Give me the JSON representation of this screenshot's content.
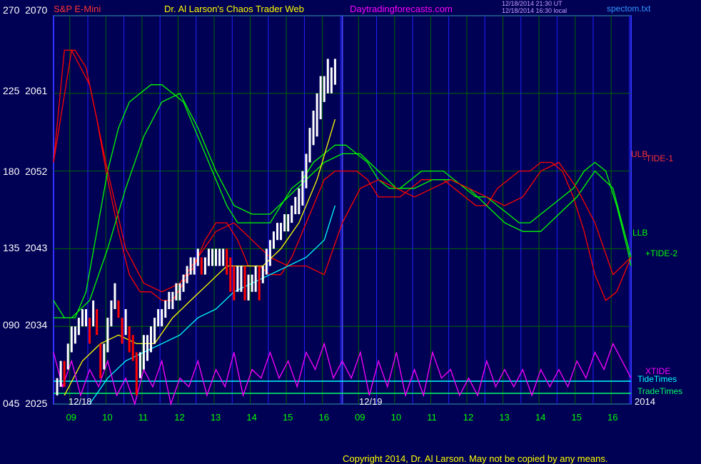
{
  "header": {
    "instrument": "S&P E-Mini",
    "site": "Dr. Al Larson's Chaos Trader Web",
    "url": "Daytradingforecasts.com",
    "timestamp_ut": "12/18/2014 21:30 UT",
    "timestamp_local": "12/18/2014 16:30 local",
    "file": "spectom.txt"
  },
  "footer": {
    "copyright": "Copyright 2014, Dr. Al Larson. May not be copied by any means."
  },
  "colors": {
    "background": "#000055",
    "plot_frame": "#3333ff",
    "grid": "#006600",
    "red": "#ff0000",
    "green": "#00ff00",
    "cyan": "#00ffff",
    "magenta": "#ff00ff",
    "yellow": "#ffff00",
    "white": "#ffffff"
  },
  "chart_data": {
    "type": "line",
    "left_axis_ticks": [
      {
        "tide": "270",
        "price": "2070",
        "value": 2070
      },
      {
        "tide": "225",
        "price": "2061",
        "value": 2061
      },
      {
        "tide": "180",
        "price": "2052",
        "value": 2052
      },
      {
        "tide": "135",
        "price": "2043",
        "value": 2043
      },
      {
        "tide": "090",
        "price": "2034",
        "value": 2034
      },
      {
        "tide": "045",
        "price": "2025",
        "value": 2025
      }
    ],
    "ylim": [
      2025,
      2070
    ],
    "x_range_hours": [
      0,
      16
    ],
    "x_hour_labels": [
      "09",
      "10",
      "11",
      "12",
      "13",
      "14",
      "15",
      "16",
      "09",
      "10",
      "11",
      "12",
      "13",
      "14",
      "15",
      "16"
    ],
    "date_labels": [
      {
        "label": "12/18",
        "x": 0.4
      },
      {
        "label": "12/19",
        "x": 8.5
      },
      {
        "label": "2014",
        "x": 16.1
      }
    ],
    "day_divider_x": 8,
    "now_x": 7.9,
    "right_labels": {
      "ulb": "ULB",
      "tide1": "-TIDE-1",
      "llb": "LLB",
      "tide2": "+TIDE-2",
      "xtide": "XTIDE",
      "tide_times": "TideTimes",
      "trade_times": "TradeTimes"
    },
    "price_series": {
      "name": "S&P E-Mini",
      "x": [
        0.1,
        0.2,
        0.3,
        0.4,
        0.5,
        0.6,
        0.7,
        0.8,
        0.9,
        1.0,
        1.1,
        1.2,
        1.3,
        1.4,
        1.5,
        1.6,
        1.7,
        1.8,
        1.9,
        2.0,
        2.1,
        2.2,
        2.3,
        2.4,
        2.5,
        2.6,
        2.7,
        2.8,
        2.9,
        3.0,
        3.1,
        3.2,
        3.3,
        3.4,
        3.5,
        3.6,
        3.7,
        3.8,
        3.9,
        4.0,
        4.1,
        4.2,
        4.3,
        4.4,
        4.5,
        4.6,
        4.7,
        4.8,
        4.9,
        5.0,
        5.1,
        5.2,
        5.3,
        5.4,
        5.5,
        5.6,
        5.7,
        5.8,
        5.9,
        6.0,
        6.1,
        6.2,
        6.3,
        6.4,
        6.5,
        6.6,
        6.7,
        6.8,
        6.9,
        7.0,
        7.1,
        7.2,
        7.3,
        7.4,
        7.5,
        7.6,
        7.7,
        7.8
      ],
      "close": [
        2027,
        2029,
        2028,
        2031,
        2033,
        2033,
        2034,
        2035,
        2035,
        2034,
        2036,
        2035,
        2030,
        2031,
        2033,
        2036,
        2038,
        2036,
        2034,
        2035,
        2033,
        2032,
        2029,
        2030,
        2031,
        2032,
        2032,
        2034,
        2035,
        2035,
        2036,
        2037,
        2037,
        2038,
        2038,
        2039,
        2040,
        2041,
        2041,
        2042,
        2041,
        2041,
        2042,
        2042,
        2042,
        2042,
        2043,
        2042,
        2040,
        2039,
        2040,
        2040,
        2039,
        2039,
        2039,
        2040,
        2039,
        2040,
        2042,
        2043,
        2044,
        2045,
        2045,
        2046,
        2046,
        2047,
        2048,
        2049,
        2050,
        2052,
        2055,
        2057,
        2059,
        2061,
        2062,
        2063,
        2063,
        2064
      ],
      "high": [
        2028,
        2030,
        2030,
        2032,
        2034,
        2034,
        2035,
        2036,
        2036,
        2035,
        2037,
        2036,
        2032,
        2032,
        2035,
        2037,
        2039,
        2037,
        2035,
        2036,
        2034,
        2033,
        2031,
        2031,
        2033,
        2033,
        2034,
        2035,
        2036,
        2036,
        2037,
        2038,
        2038,
        2039,
        2039,
        2040,
        2041,
        2042,
        2042,
        2043,
        2042,
        2042,
        2043,
        2043,
        2043,
        2043,
        2043,
        2043,
        2042,
        2041,
        2041,
        2041,
        2041,
        2040,
        2040,
        2041,
        2041,
        2041,
        2043,
        2044,
        2045,
        2046,
        2046,
        2047,
        2047,
        2048,
        2049,
        2050,
        2052,
        2054,
        2057,
        2059,
        2061,
        2063,
        2063,
        2065,
        2064,
        2065
      ],
      "low": [
        2026,
        2027,
        2027,
        2029,
        2031,
        2032,
        2033,
        2034,
        2034,
        2032,
        2034,
        2033,
        2028,
        2029,
        2031,
        2034,
        2036,
        2035,
        2032,
        2033,
        2031,
        2030,
        2026,
        2028,
        2029,
        2030,
        2031,
        2032,
        2034,
        2034,
        2035,
        2036,
        2036,
        2037,
        2037,
        2038,
        2039,
        2040,
        2040,
        2041,
        2040,
        2040,
        2041,
        2041,
        2041,
        2041,
        2041,
        2040,
        2038,
        2037,
        2038,
        2038,
        2037,
        2037,
        2038,
        2038,
        2037,
        2039,
        2040,
        2041,
        2043,
        2044,
        2044,
        2045,
        2045,
        2046,
        2047,
        2047,
        2048,
        2050,
        2053,
        2055,
        2056,
        2058,
        2060,
        2061,
        2061,
        2062
      ]
    },
    "series": [
      {
        "name": "ULB",
        "color": "#ff0000",
        "x": [
          0,
          0.3,
          0.6,
          0.9,
          1.2,
          1.5,
          1.8,
          2.1,
          2.4,
          2.7,
          3.0,
          3.3,
          3.6,
          3.9,
          4.2,
          4.5,
          4.8,
          5.1,
          5.4,
          5.7,
          6.0,
          6.3,
          6.6,
          6.9,
          7.2,
          7.5,
          7.8,
          8.1,
          8.4,
          8.7,
          9.0,
          9.3,
          9.6,
          9.9,
          10.2,
          10.5,
          10.8,
          11.1,
          11.4,
          11.7,
          12.0,
          12.3,
          12.6,
          12.9,
          13.2,
          13.5,
          13.8,
          14.1,
          14.4,
          14.7,
          15.0,
          15.3,
          15.6,
          15.9,
          16.0
        ],
        "y": [
          2053,
          2066,
          2066,
          2064,
          2058,
          2051,
          2045,
          2040,
          2038,
          2038,
          2037,
          2037,
          2039,
          2041,
          2044,
          2046,
          2046,
          2044,
          2041,
          2041,
          2040,
          2040,
          2042,
          2045,
          2048,
          2051,
          2052,
          2052,
          2052,
          2051,
          2049,
          2049,
          2049,
          2050,
          2051,
          2051,
          2051,
          2050,
          2049,
          2048,
          2048,
          2050,
          2051,
          2052,
          2052,
          2053,
          2053,
          2052,
          2049,
          2045,
          2040,
          2037,
          2038,
          2041,
          2042
        ]
      },
      {
        "name": "LLB",
        "color": "#00ff00",
        "x": [
          0,
          0.3,
          0.6,
          0.9,
          1.2,
          1.5,
          1.8,
          2.1,
          2.4,
          2.7,
          3.0,
          3.3,
          3.6,
          3.9,
          4.2,
          4.5,
          4.8,
          5.1,
          5.4,
          5.7,
          6.0,
          6.3,
          6.6,
          6.9,
          7.2,
          7.5,
          7.8,
          8.1,
          8.4,
          8.7,
          9.0,
          9.3,
          9.6,
          9.9,
          10.2,
          10.5,
          10.8,
          11.1,
          11.4,
          11.7,
          12.0,
          12.3,
          12.6,
          12.9,
          13.2,
          13.5,
          13.8,
          14.1,
          14.4,
          14.7,
          15.0,
          15.3,
          15.6,
          15.9,
          16.0
        ],
        "y": [
          2037,
          2035,
          2035,
          2038,
          2045,
          2052,
          2057,
          2060,
          2061,
          2062,
          2062,
          2061,
          2060,
          2057,
          2054,
          2051,
          2048,
          2046,
          2046,
          2046,
          2046,
          2048,
          2050,
          2051,
          2053,
          2054,
          2055,
          2055,
          2054,
          2053,
          2051,
          2050,
          2050,
          2051,
          2052,
          2052,
          2052,
          2051,
          2050,
          2049,
          2049,
          2048,
          2047,
          2046,
          2046,
          2047,
          2048,
          2049,
          2050,
          2052,
          2053,
          2052,
          2048,
          2043,
          2041
        ]
      },
      {
        "name": "+TIDE-2",
        "color": "#00ff00",
        "x": [
          0,
          0.5,
          1.0,
          1.5,
          2.0,
          2.5,
          3.0,
          3.5,
          4.0,
          4.5,
          5.0,
          5.5,
          6.0,
          6.5,
          7.0,
          7.5,
          8.0,
          8.5,
          9.0,
          9.5,
          10.0,
          10.5,
          11.0,
          11.5,
          12.0,
          12.5,
          13.0,
          13.5,
          14.0,
          14.5,
          15.0,
          15.5,
          16.0
        ],
        "y": [
          2035,
          2035,
          2037,
          2043,
          2050,
          2056,
          2060,
          2061,
          2057,
          2052,
          2048,
          2047,
          2047,
          2049,
          2051,
          2053,
          2054,
          2054,
          2052,
          2050,
          2050,
          2051,
          2051,
          2050,
          2048,
          2046,
          2045,
          2045,
          2047,
          2049,
          2052,
          2050,
          2042
        ]
      },
      {
        "name": "-TIDE-1",
        "color": "#ff0000",
        "x": [
          0,
          0.5,
          1.0,
          1.5,
          2.0,
          2.5,
          3.0,
          3.5,
          4.0,
          4.5,
          5.0,
          5.5,
          6.0,
          6.5,
          7.0,
          7.5,
          8.0,
          8.5,
          9.0,
          9.5,
          10.0,
          10.5,
          11.0,
          11.5,
          12.0,
          12.5,
          13.0,
          13.5,
          14.0,
          14.5,
          15.0,
          15.5,
          16.0
        ],
        "y": [
          2053,
          2066,
          2062,
          2052,
          2043,
          2039,
          2038,
          2039,
          2042,
          2045,
          2046,
          2044,
          2042,
          2041,
          2041,
          2040,
          2046,
          2050,
          2051,
          2050,
          2049,
          2050,
          2051,
          2050,
          2049,
          2048,
          2049,
          2052,
          2053,
          2050,
          2046,
          2040,
          2042
        ]
      },
      {
        "name": "yellow-ma",
        "color": "#ffff00",
        "x": [
          0.3,
          0.8,
          1.3,
          1.8,
          2.3,
          2.8,
          3.3,
          3.8,
          4.3,
          4.8,
          5.3,
          5.8,
          6.3,
          6.8,
          7.3,
          7.8
        ],
        "y": [
          2026,
          2030,
          2032,
          2033,
          2032,
          2032,
          2035,
          2037,
          2039,
          2041,
          2041,
          2041,
          2043,
          2046,
          2051,
          2058
        ]
      },
      {
        "name": "cyan-ma",
        "color": "#00ffff",
        "x": [
          1.0,
          1.5,
          2.0,
          2.5,
          3.0,
          3.5,
          4.0,
          4.5,
          5.0,
          5.5,
          6.0,
          6.5,
          7.0,
          7.5,
          7.8
        ],
        "y": [
          2025,
          2028,
          2030,
          2031,
          2032,
          2033,
          2035,
          2036,
          2038,
          2039,
          2040,
          2041,
          2042,
          2044,
          2048
        ]
      },
      {
        "name": "XTIDE",
        "color": "#ff00ff",
        "x": [
          0,
          0.25,
          0.5,
          0.75,
          1.0,
          1.25,
          1.5,
          1.75,
          2.0,
          2.25,
          2.5,
          2.75,
          3.0,
          3.25,
          3.5,
          3.75,
          4.0,
          4.25,
          4.5,
          4.75,
          5.0,
          5.25,
          5.5,
          5.75,
          6.0,
          6.25,
          6.5,
          6.75,
          7.0,
          7.25,
          7.5,
          7.75,
          8.0,
          8.25,
          8.5,
          8.75,
          9.0,
          9.25,
          9.5,
          9.75,
          10.0,
          10.25,
          10.5,
          10.75,
          11.0,
          11.25,
          11.5,
          11.75,
          12.0,
          12.25,
          12.5,
          12.75,
          13.0,
          13.25,
          13.5,
          13.75,
          14.0,
          14.25,
          14.5,
          14.75,
          15.0,
          15.25,
          15.5,
          15.75,
          16.0
        ],
        "y": [
          2031,
          2027,
          2030,
          2026,
          2029,
          2027,
          2030,
          2026,
          2028,
          2025,
          2029,
          2027,
          2030,
          2025,
          2028,
          2027,
          2030,
          2026,
          2029,
          2027,
          2031,
          2026,
          2029,
          2028,
          2031,
          2028,
          2030,
          2027,
          2031,
          2029,
          2032,
          2028,
          2030,
          2028,
          2031,
          2026,
          2030,
          2027,
          2031,
          2026,
          2029,
          2026,
          2031,
          2028,
          2029,
          2026,
          2028,
          2026,
          2030,
          2027,
          2029,
          2027,
          2029,
          2026,
          2029,
          2027,
          2029,
          2027,
          2030,
          2028,
          2031,
          2029,
          2032,
          2030,
          2028
        ]
      }
    ]
  }
}
